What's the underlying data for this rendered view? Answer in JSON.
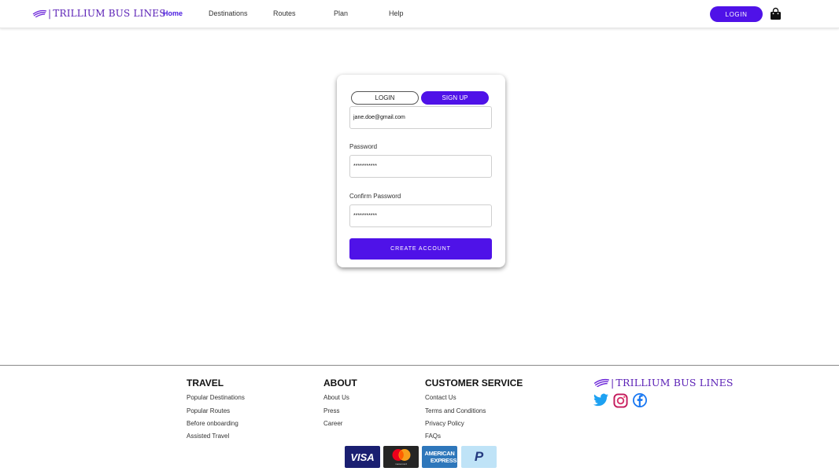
{
  "brand": {
    "name": "TRILLIUM BUS LINES",
    "separator": "|",
    "color": "#5b21b6"
  },
  "nav": {
    "links": [
      {
        "label": "Home",
        "active": true
      },
      {
        "label": "Destinations",
        "active": false
      },
      {
        "label": "Routes",
        "active": false
      },
      {
        "label": "Plan",
        "active": false
      },
      {
        "label": "Help",
        "active": false
      }
    ],
    "login_label": "LOGIN",
    "cart_icon": "shopping-bag-icon"
  },
  "auth_card": {
    "tabs": {
      "login": "LOGIN",
      "signup": "SIGN UP",
      "selected": "signup"
    },
    "email_value": "jane.doe@gmail.com",
    "password_label": "Password",
    "password_value": "***********",
    "confirm_label": "Confirm Password",
    "confirm_value": "***********",
    "submit_label": "CREATE ACCOUNT"
  },
  "footer": {
    "travel": {
      "heading": "TRAVEL",
      "links": [
        "Popular Destinations",
        "Popular Routes",
        "Before onboarding",
        "Assisted Travel"
      ]
    },
    "about": {
      "heading": "ABOUT",
      "links": [
        "About Us",
        "Press",
        "Career"
      ]
    },
    "service": {
      "heading": "CUSTOMER SERVICE",
      "links": [
        "Contact Us",
        "Terms and Conditions",
        "Privacy Policy",
        "FAQs"
      ]
    },
    "social_icons": [
      "twitter-icon",
      "instagram-icon",
      "facebook-icon"
    ],
    "payment_logos": {
      "visa": "VISA",
      "mastercard": "mastercard",
      "amex_line1": "AMERICAN",
      "amex_line2": "EXPRESS",
      "paypal": "P"
    }
  },
  "colors": {
    "accent": "#4f12e8",
    "twitter": "#1da1f2",
    "facebook": "#1877f2",
    "visa": "#1a1f71",
    "mastercard": "#252525",
    "amex": "#2e77bb",
    "paypal_bg": "#bfe3f7"
  }
}
